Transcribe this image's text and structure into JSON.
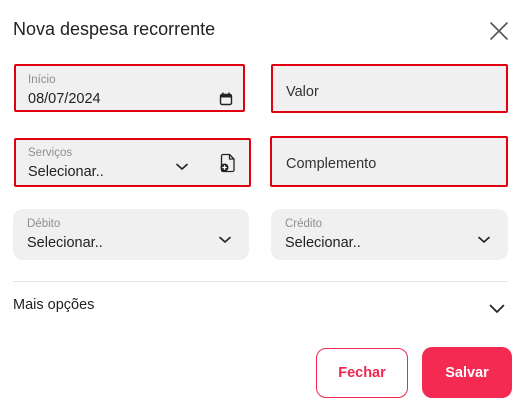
{
  "modal": {
    "title": "Nova despesa recorrente"
  },
  "form": {
    "inicio": {
      "label": "Início",
      "value": "08/07/2024"
    },
    "valor": {
      "placeholder": "Valor"
    },
    "servicos": {
      "label": "Serviços",
      "value": "Selecionar.."
    },
    "complemento": {
      "placeholder": "Complemento"
    },
    "debito": {
      "label": "Débito",
      "value": "Selecionar.."
    },
    "credito": {
      "label": "Crédito",
      "value": "Selecionar.."
    }
  },
  "more_options": {
    "label": "Mais opções"
  },
  "actions": {
    "close_label": "Fechar",
    "save_label": "Salvar"
  },
  "colors": {
    "error_border": "#e00012",
    "primary": "#f52a52",
    "field_bg": "#f0f0f0"
  }
}
